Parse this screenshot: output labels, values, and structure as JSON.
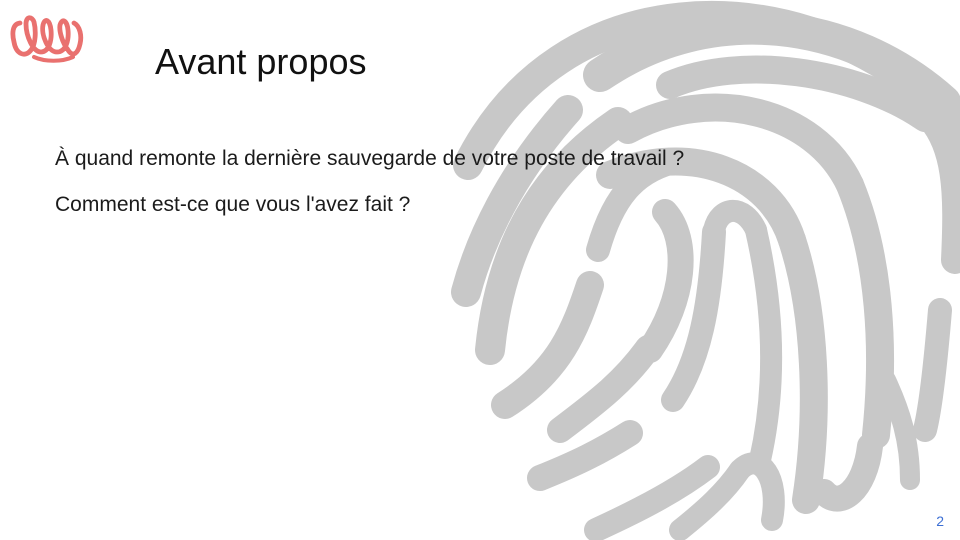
{
  "slide": {
    "title": "Avant propos",
    "lines": [
      "À quand remonte la dernière sauvegarde de votre poste de travail ?",
      "Comment est-ce que vous l'avez fait ?"
    ],
    "page_number": "2"
  },
  "icons": {
    "logo": "brand-logo",
    "background": "fingerprint-icon"
  },
  "colors": {
    "logo": "#e9716f",
    "fingerprint": "#c8c8c8",
    "page_number": "#3c6fd4",
    "text": "#1b1b1b"
  }
}
